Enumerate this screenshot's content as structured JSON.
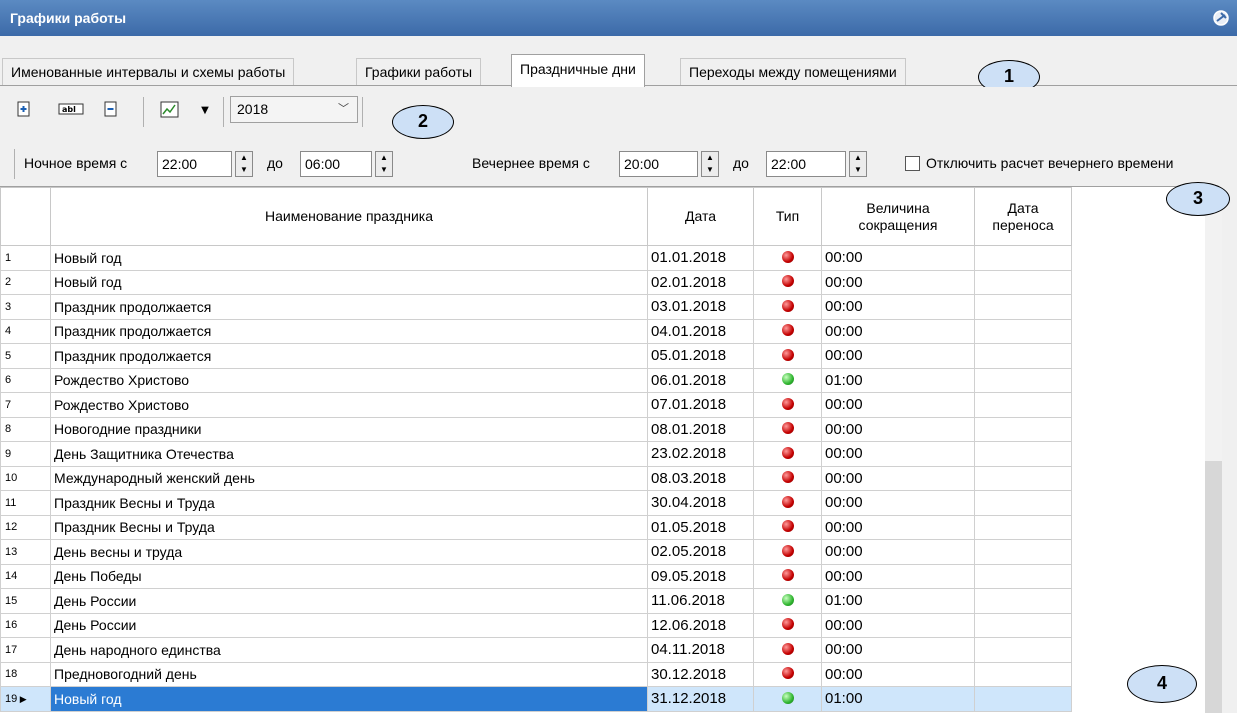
{
  "window": {
    "title": "Графики работы"
  },
  "tabs": [
    {
      "label": "Именованные интервалы и схемы работы"
    },
    {
      "label": "Графики работы"
    },
    {
      "label": "Праздничные дни"
    },
    {
      "label": "Переходы между помещениями"
    }
  ],
  "callouts": [
    "1",
    "2",
    "3",
    "4"
  ],
  "toolbar": {
    "year": "2018",
    "icons": [
      "add-icon",
      "rename-icon",
      "delete-icon",
      "chart-icon",
      "dropdown-arrow-icon"
    ]
  },
  "time_settings": {
    "night_label": "Ночное время с",
    "night_from": "22:00",
    "night_to_label": "до",
    "night_to": "06:00",
    "evening_label": "Вечернее время с",
    "evening_from": "20:00",
    "evening_to_label": "до",
    "evening_to": "22:00",
    "disable_evening_label": "Отключить расчет вечернего времени",
    "disable_evening_checked": false
  },
  "table": {
    "headers": {
      "name": "Наименование праздника",
      "date": "Дата",
      "type": "Тип",
      "reduction_line1": "Величина",
      "reduction_line2": "сокращения",
      "transfer_line1": "Дата",
      "transfer_line2": "переноса"
    },
    "rows": [
      {
        "n": "1",
        "name": "Новый год",
        "date": "01.01.2018",
        "type": "off",
        "reduction": "00:00",
        "transfer": ""
      },
      {
        "n": "2",
        "name": "Новый год",
        "date": "02.01.2018",
        "type": "off",
        "reduction": "00:00",
        "transfer": ""
      },
      {
        "n": "3",
        "name": "Праздник продолжается",
        "date": "03.01.2018",
        "type": "off",
        "reduction": "00:00",
        "transfer": ""
      },
      {
        "n": "4",
        "name": "Праздник продолжается",
        "date": "04.01.2018",
        "type": "off",
        "reduction": "00:00",
        "transfer": ""
      },
      {
        "n": "5",
        "name": "Праздник продолжается",
        "date": "05.01.2018",
        "type": "off",
        "reduction": "00:00",
        "transfer": ""
      },
      {
        "n": "6",
        "name": "Рождество Христово",
        "date": "06.01.2018",
        "type": "on",
        "reduction": "01:00",
        "transfer": ""
      },
      {
        "n": "7",
        "name": "Рождество Христово",
        "date": "07.01.2018",
        "type": "off",
        "reduction": "00:00",
        "transfer": ""
      },
      {
        "n": "8",
        "name": "Новогодние праздники",
        "date": "08.01.2018",
        "type": "off",
        "reduction": "00:00",
        "transfer": ""
      },
      {
        "n": "9",
        "name": "День Защитника Отечества",
        "date": "23.02.2018",
        "type": "off",
        "reduction": "00:00",
        "transfer": ""
      },
      {
        "n": "10",
        "name": "Международный женский день",
        "date": "08.03.2018",
        "type": "off",
        "reduction": "00:00",
        "transfer": ""
      },
      {
        "n": "11",
        "name": "Праздник Весны и Труда",
        "date": "30.04.2018",
        "type": "off",
        "reduction": "00:00",
        "transfer": ""
      },
      {
        "n": "12",
        "name": "Праздник Весны и Труда",
        "date": "01.05.2018",
        "type": "off",
        "reduction": "00:00",
        "transfer": ""
      },
      {
        "n": "13",
        "name": "День весны и труда",
        "date": "02.05.2018",
        "type": "off",
        "reduction": "00:00",
        "transfer": ""
      },
      {
        "n": "14",
        "name": "День Победы",
        "date": "09.05.2018",
        "type": "off",
        "reduction": "00:00",
        "transfer": ""
      },
      {
        "n": "15",
        "name": "День России",
        "date": "11.06.2018",
        "type": "on",
        "reduction": "01:00",
        "transfer": ""
      },
      {
        "n": "16",
        "name": "День России",
        "date": "12.06.2018",
        "type": "off",
        "reduction": "00:00",
        "transfer": ""
      },
      {
        "n": "17",
        "name": "День народного единства",
        "date": "04.11.2018",
        "type": "off",
        "reduction": "00:00",
        "transfer": ""
      },
      {
        "n": "18",
        "name": "Предновогодний день",
        "date": "30.12.2018",
        "type": "off",
        "reduction": "00:00",
        "transfer": ""
      },
      {
        "n": "19",
        "name": "Новый год",
        "date": "31.12.2018",
        "type": "on",
        "reduction": "01:00",
        "transfer": "",
        "selected": true
      }
    ]
  },
  "colors": {
    "titlebar": "#3c6aa8",
    "selection": "#2b7bd3",
    "selection_row": "#cfe6fb",
    "callout": "#cde0f6"
  }
}
